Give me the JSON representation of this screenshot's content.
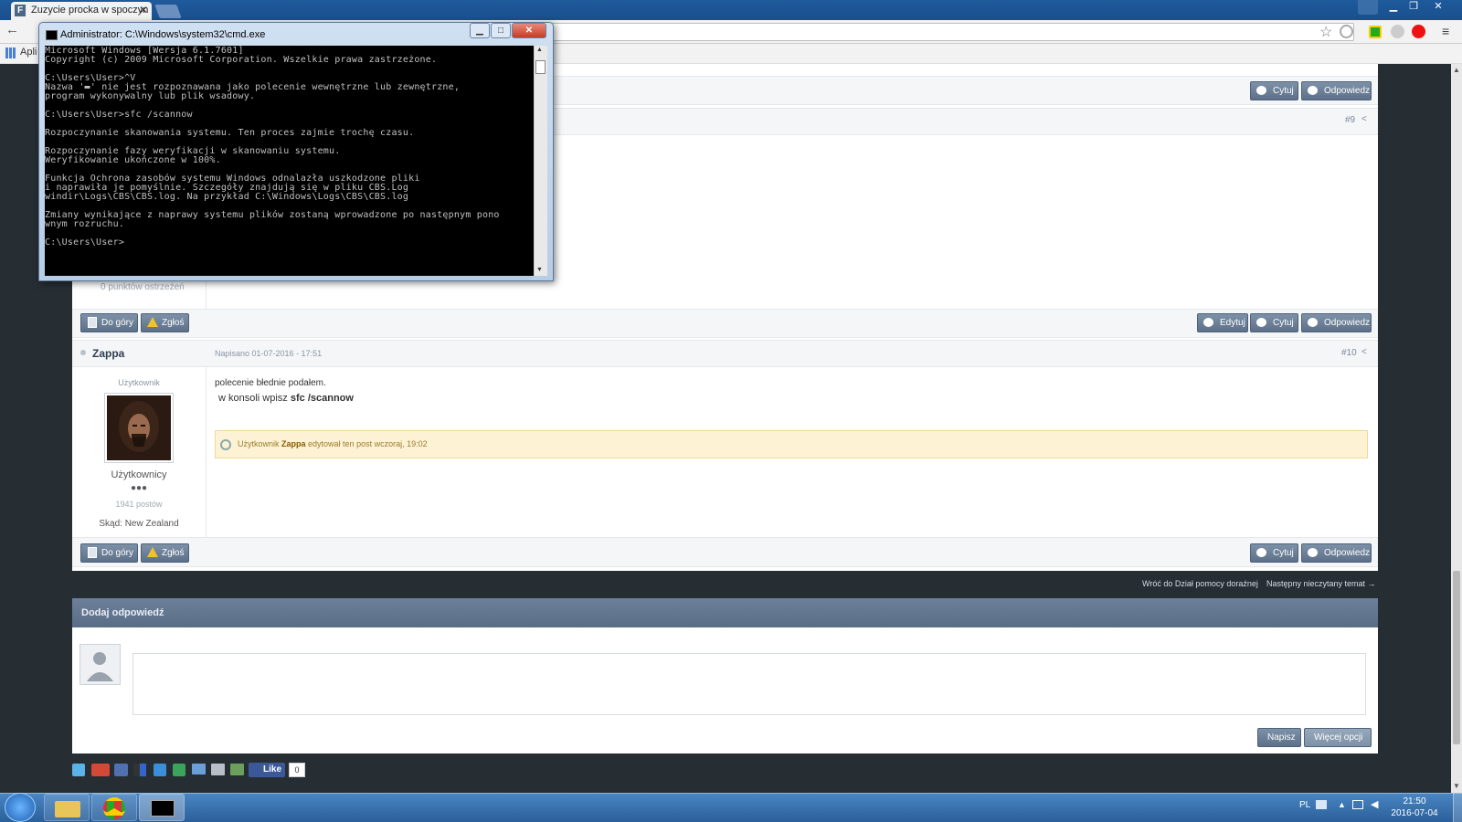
{
  "browser": {
    "tab_title": "Zuzycie procka w spoczyn",
    "tab_favicon": "F",
    "tab_close": "✕",
    "bookmarks_apps": "Apli"
  },
  "cmd": {
    "title": "Administrator: C:\\Windows\\system32\\cmd.exe",
    "lines": [
      "Microsoft Windows [Wersja 6.1.7601]",
      "Copyright (c) 2009 Microsoft Corporation. Wszelkie prawa zastrzeżone.",
      "",
      "C:\\Users\\User>^V",
      "Nazwa '▬' nie jest rozpoznawana jako polecenie wewnętrzne lub zewnętrzne,",
      "program wykonywalny lub plik wsadowy.",
      "",
      "C:\\Users\\User>sfc /scannow",
      "",
      "Rozpoczynanie skanowania systemu. Ten proces zajmie trochę czasu.",
      "",
      "Rozpoczynanie fazy weryfikacji w skanowaniu systemu.",
      "Weryfikowanie ukończone w 100%.",
      "",
      "Funkcja Ochrona zasobów systemu Windows odnalazła uszkodzone pliki",
      "i naprawiła je pomyślnie. Szczegóły znajdują się w pliku CBS.Log",
      "windir\\Logs\\CBS\\CBS.log. Na przykład C:\\Windows\\Logs\\CBS\\CBS.log",
      "",
      "Zmiany wynikające z naprawy systemu plików zostaną wprowadzone po następnym pono",
      "wnym rozruchu.",
      "",
      "C:\\Users\\User>"
    ]
  },
  "post8": {
    "quote_label": "Cytuj",
    "reply_label": "Odpowiedz"
  },
  "post9": {
    "number": "#9",
    "warnings": "0 punktów ostrzeżeń",
    "top_label": "Do góry",
    "report_label": "Zgłoś",
    "edit_label": "Edytuj",
    "quote_label": "Cytuj",
    "reply_label": "Odpowiedz"
  },
  "post10": {
    "author": "Zappa",
    "date": "Napisano 01-07-2016 - 17:51",
    "number": "#10",
    "role_title": "Użytkownik",
    "group": "Użytkownicy",
    "pips": "●●●",
    "post_count": "1941 postów",
    "location": "Skąd: New Zealand",
    "body_line1": "polecenie błednie podałem.",
    "body_line2_prefix": "w konsoli wpisz ",
    "body_line2_bold": "sfc /scannow",
    "edit_prefix": "Użytkownik ",
    "edit_user": "Zappa",
    "edit_suffix": " edytował ten post wczoraj, 19:02",
    "top_label": "Do góry",
    "report_label": "Zgłoś",
    "quote_label": "Cytuj",
    "reply_label": "Odpowiedz"
  },
  "nav": {
    "back_link": "Wróć do Dział pomocy doraźnej",
    "next_link": "Następny nieczytany temat →"
  },
  "reply": {
    "heading": "Dodaj odpowiedź",
    "submit_label": "Napisz",
    "more_label": "Więcej opcji"
  },
  "share": {
    "like_label": "Like",
    "like_count": "0"
  },
  "taskbar": {
    "lang": "PL",
    "time": "21:50",
    "date": "2016-07-04"
  },
  "colors": {
    "page_bg": "#262d33",
    "button": "#5d7089",
    "edit_notice_bg": "#fdf3d4",
    "taskbar": "#2a5f9a"
  }
}
